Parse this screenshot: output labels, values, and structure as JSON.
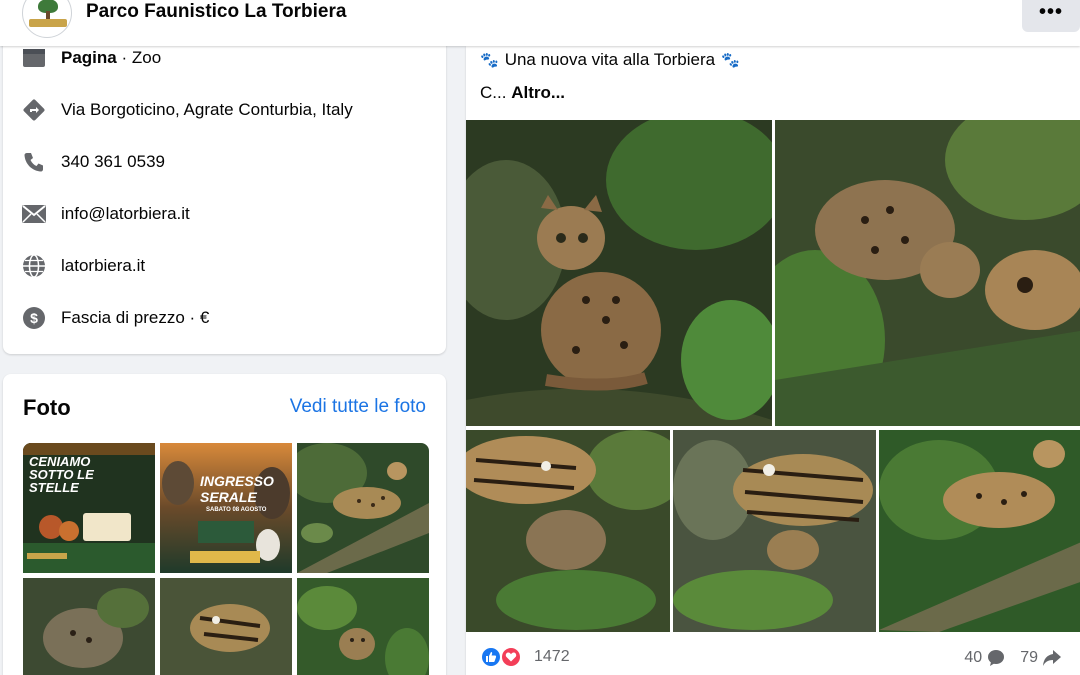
{
  "header": {
    "page_name": "Parco Faunistico La Torbiera",
    "more_label": "•••",
    "logo_text": "Parco Faunistico LA TORBIERA"
  },
  "info": {
    "category_prefix": "Pagina",
    "category_suffix": " · Zoo",
    "address": "Via Borgoticino, Agrate Conturbia, Italy",
    "phone": "340 361 0539",
    "email": "info@latorbiera.it",
    "website": "latorbiera.it",
    "price": "Fascia di prezzo · €",
    "icons": [
      "page-icon",
      "directions-icon",
      "phone-icon",
      "email-icon",
      "globe-icon",
      "price-icon"
    ]
  },
  "photos": {
    "title": "Foto",
    "see_all": "Vedi tutte le foto",
    "thumbs": [
      {
        "name": "event-poster-stelle",
        "text": "CENIAMO SOTTO LE STELLE"
      },
      {
        "name": "event-poster-serale",
        "text": "INGRESSO SERALE",
        "subtext": "SABATO 08 AGOSTO"
      },
      {
        "name": "ocelot-photo-1"
      },
      {
        "name": "ocelot-photo-2"
      },
      {
        "name": "ocelot-photo-3"
      },
      {
        "name": "ocelot-photo-4"
      }
    ]
  },
  "post": {
    "text": "Una nuova vita alla Torbiera",
    "truncated_prefix": "C...",
    "more_link": "Altro...",
    "reaction_count": "1472",
    "comment_count": "40",
    "share_count": "79",
    "colors": {
      "like": "#1877f2",
      "love": "#f33e58",
      "link": "#1b74e4"
    }
  }
}
